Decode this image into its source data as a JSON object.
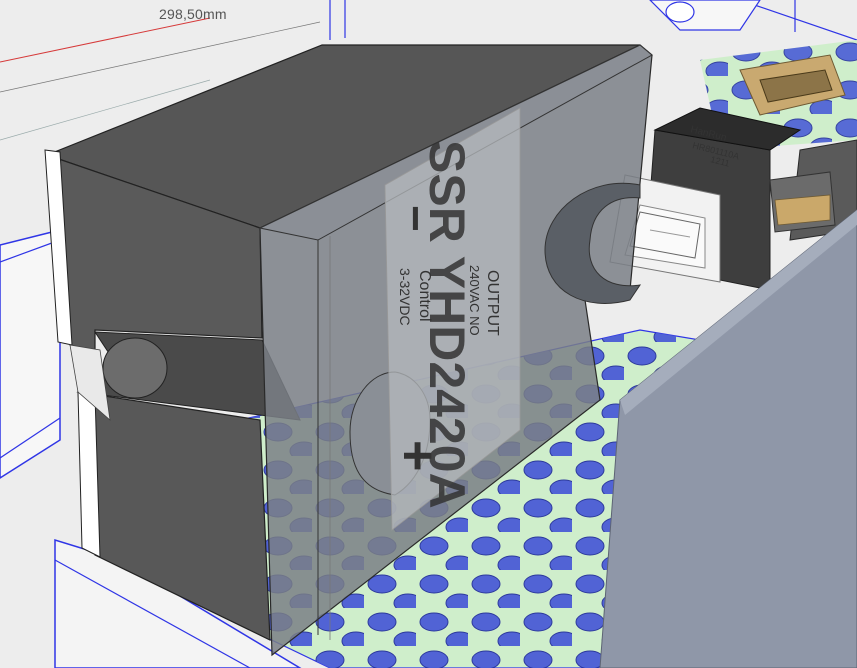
{
  "viewport": {
    "dimension_label": "298,50mm"
  },
  "ssr_label": {
    "model": "SSR YHD2420A",
    "output_title": "OUTPUT",
    "output_rating": "240VAC NO",
    "control_title": "Control",
    "control_rating": "3-32VDC",
    "minus_sign": "−",
    "plus_sign": "+"
  },
  "ethernet_jack": {
    "brand": "HanRun",
    "part_number": "HR801110A",
    "date_code": "1211"
  },
  "colors": {
    "background": "#ededed",
    "axis_red": "#d63a3a",
    "edge_blue": "#2f35e6",
    "pcb_green": "#cfeecb",
    "hole_blue": "#4a5cd6",
    "ssr_dark": "#555555",
    "ssr_translucent": "#7a7f86",
    "enclosure_gray": "#8f97a8"
  }
}
